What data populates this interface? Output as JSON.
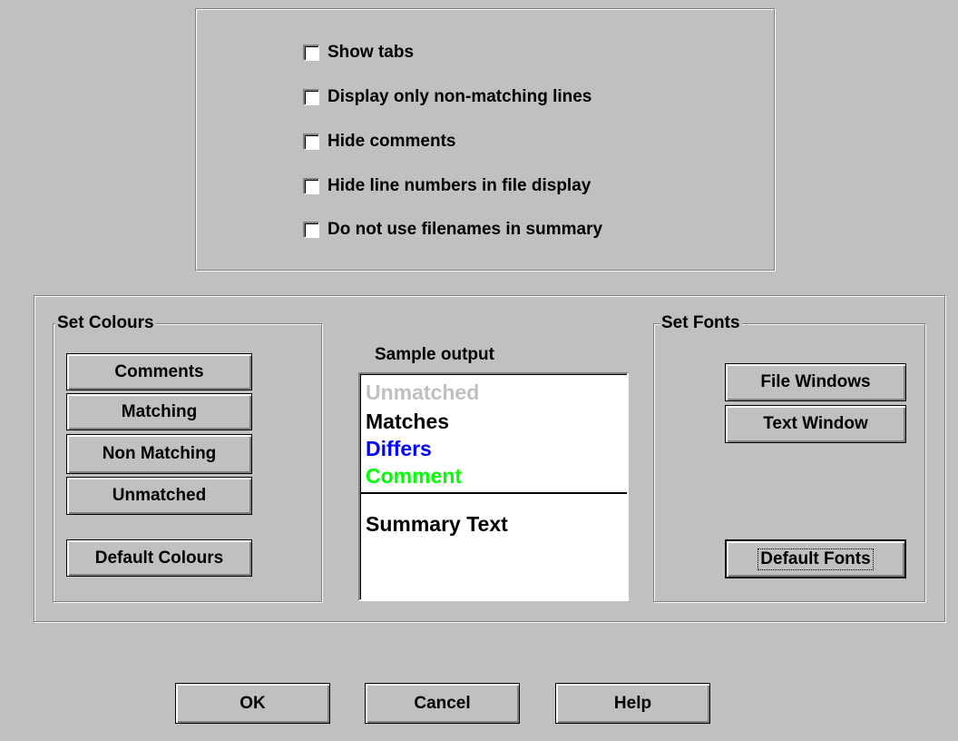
{
  "options": {
    "checkboxes": [
      {
        "label": "Show tabs",
        "checked": false
      },
      {
        "label": "Display only non-matching lines",
        "checked": false
      },
      {
        "label": "Hide comments",
        "checked": false
      },
      {
        "label": "Hide line numbers in file display",
        "checked": false
      },
      {
        "label": "Do not use filenames in summary",
        "checked": false
      }
    ]
  },
  "colours": {
    "title": "Set Colours",
    "comments": "Comments",
    "matching": "Matching",
    "non_matching": "Non Matching",
    "unmatched": "Unmatched",
    "default": "Default Colours"
  },
  "sample": {
    "title": "Sample output",
    "unmatched": {
      "text": "Unmatched",
      "color": "#c0c0c0"
    },
    "matches": {
      "text": "Matches",
      "color": "#000000"
    },
    "differs": {
      "text": "Differs",
      "color": "#0000ff"
    },
    "comment": {
      "text": "Comment",
      "color": "#00ff00"
    },
    "summary": "Summary Text"
  },
  "fonts": {
    "title": "Set Fonts",
    "file_windows": "File Windows",
    "text_window": "Text Window",
    "default": "Default Fonts"
  },
  "dialog": {
    "ok": "OK",
    "cancel": "Cancel",
    "help": "Help"
  }
}
